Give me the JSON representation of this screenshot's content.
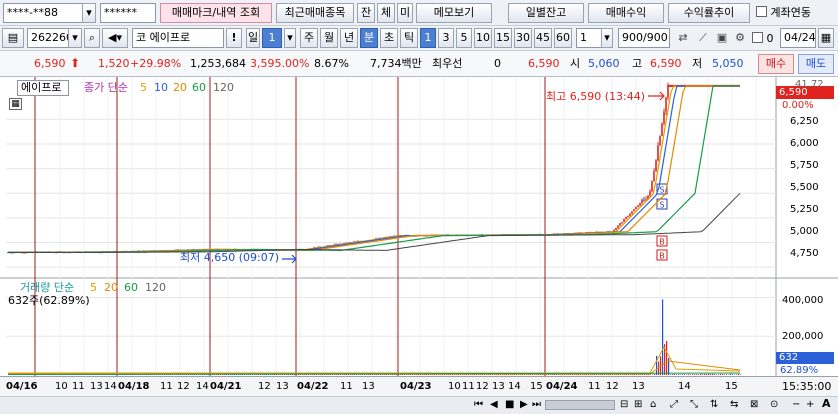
{
  "toolbar1": {
    "account_no": "****-**88",
    "password": "******",
    "tabs": [
      "매매마크/내역 조회",
      "최근매매종목",
      "잔",
      "체",
      "미",
      "메모보기"
    ],
    "right_buttons": [
      "일별잔고",
      "매매수익",
      "수익률추이"
    ],
    "link_check_label": "계좌연동"
  },
  "toolbar2": {
    "stock_code": "262260",
    "market_prefix": "코",
    "stock_name": "에이프로",
    "period_buttons": [
      "일",
      "주",
      "월",
      "년",
      "분",
      "초",
      "틱"
    ],
    "selected_period": "분",
    "intervals": [
      "1",
      "3",
      "5",
      "10",
      "15",
      "30",
      "45",
      "60"
    ],
    "selected_interval": "1",
    "unit_value": "1",
    "count": "900/900",
    "check_value": "0",
    "date": "04/24"
  },
  "quote": {
    "price": "6,590",
    "change": "1,520",
    "change_pct": "+29.98%",
    "volume": "1,253,684",
    "volume_pct": "3,595.00%",
    "turnover_pct": "8.67%",
    "amount": "7,734백만",
    "priority_label": "최우선",
    "priority_value": "0",
    "ask_price": "6,590",
    "open_label": "시",
    "open": "5,060",
    "high_label": "고",
    "high": "6,590",
    "low_label": "저",
    "low": "5,050",
    "buy_button": "매수",
    "sell_button": "매도"
  },
  "chart_legend": {
    "stock_name": "에이프로",
    "price_legend": "종가 단순",
    "ma": [
      "5",
      "10",
      "20",
      "60",
      "120"
    ],
    "vol_legend": "거래량 단순",
    "vol_ma": [
      "5",
      "20",
      "60",
      "120"
    ],
    "vol_readout": "632주(62.89%)"
  },
  "annotations": {
    "high": "최고 6,590 (13:44)",
    "low": "최저 4,650 (09:07)"
  },
  "price_axis": {
    "ticks": [
      "6,250",
      "6,000",
      "5,750",
      "5,500",
      "5,250",
      "5,000",
      "4,750"
    ],
    "last_price_tag": "6,590",
    "pct_tag": "0.00%",
    "top_tag": "41.72"
  },
  "volume_axis": {
    "ticks": [
      "400,000",
      "200,000"
    ],
    "last_tag": "632",
    "pct_tag": "62.89%"
  },
  "time_axis": {
    "labels": [
      "04/16",
      "10",
      "11",
      "13",
      "14",
      "04/18",
      "11",
      "12",
      "14",
      "04/21",
      "12",
      "13",
      "04/22",
      "11",
      "13",
      "04/23",
      "10",
      "11",
      "12",
      "13",
      "14",
      "15",
      "04/24",
      "11",
      "12",
      "13",
      "14",
      "15"
    ],
    "clock": "15:35:00"
  },
  "colors": {
    "up": "#e0231f",
    "down": "#1f4fd1",
    "ma5": "#d9a000",
    "ma10": "#2c60d8",
    "ma20": "#e38a00",
    "ma60": "#1a9a4a",
    "ma120": "#444444"
  },
  "chart_data": {
    "type": "line",
    "x": [
      "04/16",
      "04/18",
      "04/21",
      "04/22",
      "04/23",
      "04/24 10:00",
      "04/24 13:00",
      "04/24 13:30",
      "04/24 13:44",
      "04/24 15:30"
    ],
    "series": [
      {
        "name": "종가",
        "values": [
          4900,
          4905,
          4930,
          4920,
          5070,
          5080,
          5110,
          5500,
          6590,
          6590
        ]
      }
    ],
    "ylim": [
      4650,
      6650
    ],
    "volume_ylim": [
      0,
      480000
    ]
  }
}
